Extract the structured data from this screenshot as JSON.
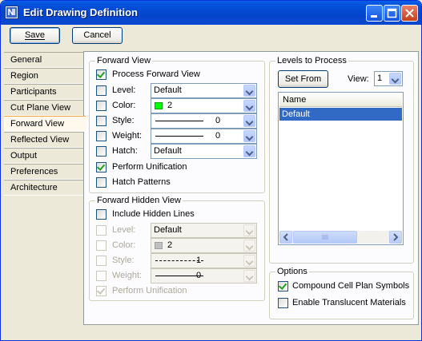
{
  "window": {
    "title": "Edit Drawing Definition"
  },
  "toolbar": {
    "save_label": "Save",
    "cancel_label": "Cancel"
  },
  "tabs": [
    "General",
    "Region",
    "Participants",
    "Cut Plane View",
    "Forward View",
    "Reflected View",
    "Output",
    "Preferences",
    "Architecture"
  ],
  "selected_tab": "Forward View",
  "forward_view": {
    "group_label": "Forward View",
    "process_label": "Process Forward View",
    "level": {
      "label": "Level:",
      "value": "Default"
    },
    "color": {
      "label": "Color:",
      "value": "2",
      "swatch": "#00ff00"
    },
    "style": {
      "label": "Style:",
      "value": "0"
    },
    "weight": {
      "label": "Weight:",
      "value": "0"
    },
    "hatch": {
      "label": "Hatch:",
      "value": "Default"
    },
    "perform_unification": "Perform Unification",
    "hatch_patterns": "Hatch Patterns"
  },
  "forward_hidden": {
    "group_label": "Forward Hidden View",
    "include_label": "Include Hidden Lines",
    "level": {
      "label": "Level:",
      "value": "Default"
    },
    "color": {
      "label": "Color:",
      "value": "2",
      "swatch": "#c0c0c0"
    },
    "style": {
      "label": "Style:",
      "value": "1"
    },
    "weight": {
      "label": "Weight:",
      "value": "0"
    },
    "perform_unification": "Perform Unification"
  },
  "levels": {
    "group_label": "Levels to Process",
    "set_from": "Set From",
    "view_label": "View:",
    "view_value": "1",
    "column": "Name",
    "items": [
      "Default"
    ]
  },
  "options": {
    "group_label": "Options",
    "compound": "Compound Cell Plan Symbols",
    "translucent": "Enable Translucent Materials"
  },
  "colors": {
    "titlebar": "#0450d8",
    "selection": "#316ac5",
    "check": "#21a121"
  }
}
